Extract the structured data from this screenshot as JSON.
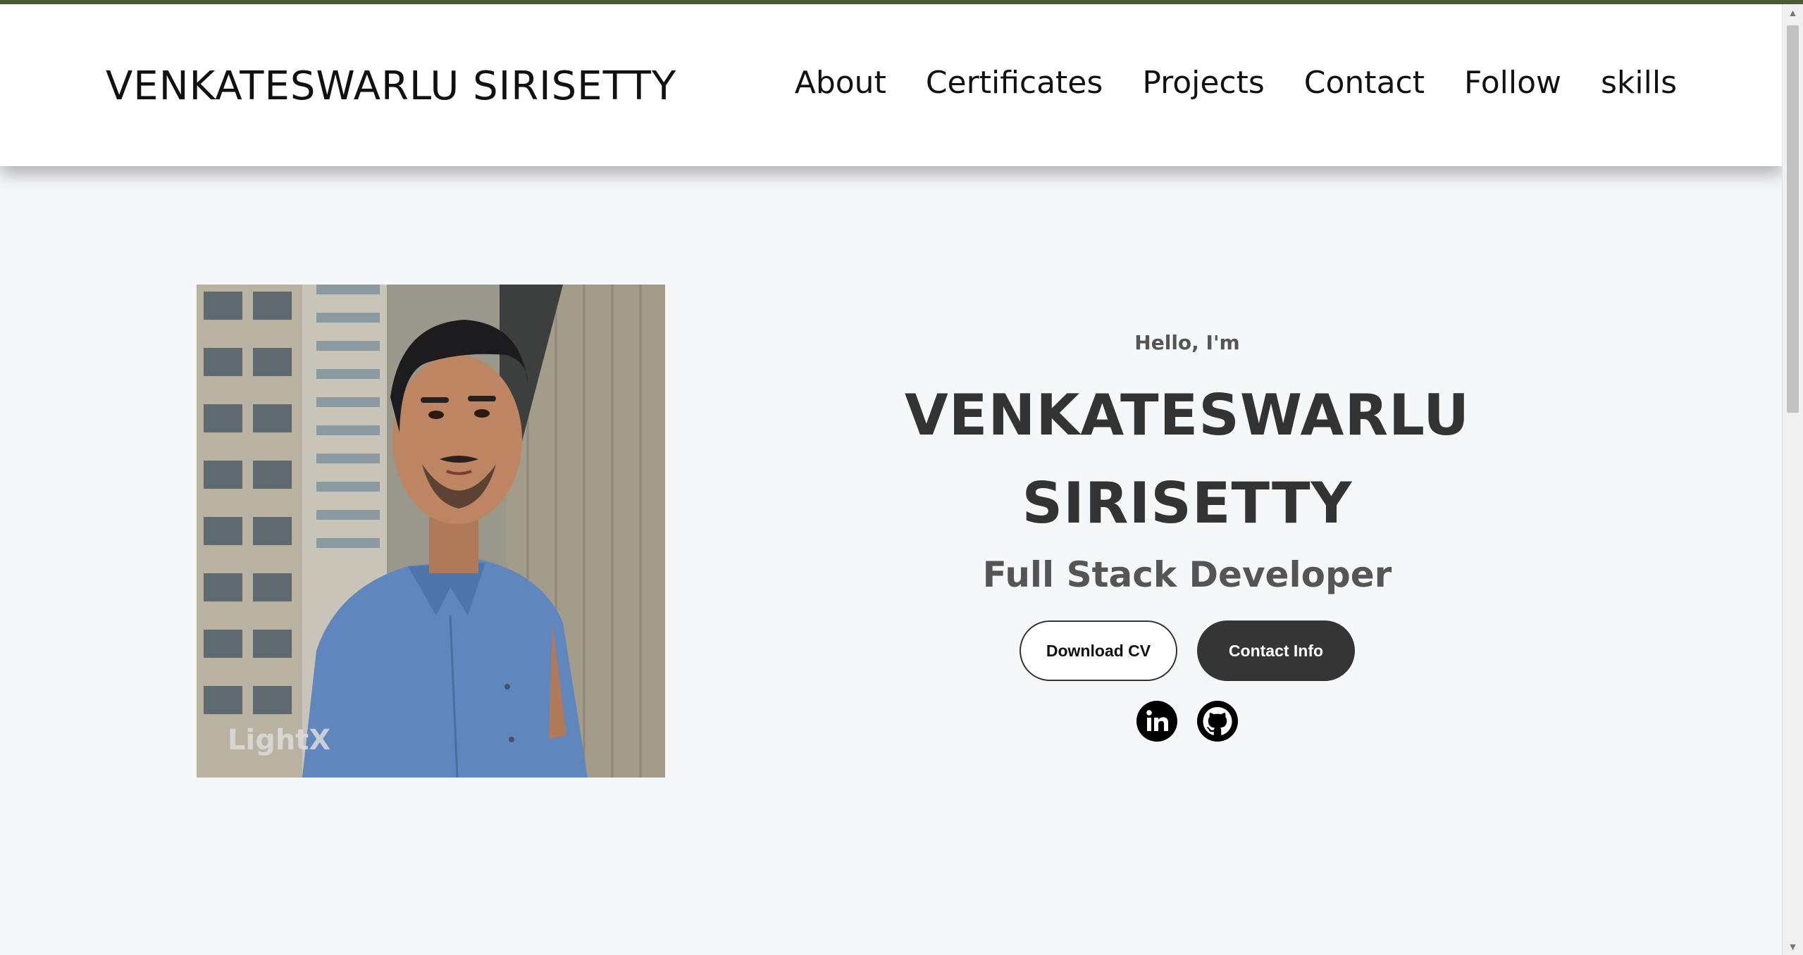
{
  "header": {
    "logo_text": "VENKATESWARLU SIRISETTY",
    "nav": [
      {
        "label": "About"
      },
      {
        "label": "Certificates"
      },
      {
        "label": "Projects"
      },
      {
        "label": "Contact"
      },
      {
        "label": "Follow"
      },
      {
        "label": "skills"
      }
    ]
  },
  "hero": {
    "greeting": "Hello, I'm",
    "name_line1": "VENKATESWARLU",
    "name_line2": "SIRISETTY",
    "role": "Full Stack Developer",
    "buttons": {
      "download_cv": "Download CV",
      "contact_info": "Contact Info"
    },
    "socials": [
      {
        "icon": "linkedin-icon"
      },
      {
        "icon": "github-icon"
      }
    ],
    "profile_image": {
      "watermark": "LightX"
    }
  },
  "colors": {
    "accent_topline": "#4f5a3b",
    "page_bg": "#f6f7f9",
    "dark_button": "#353535"
  }
}
